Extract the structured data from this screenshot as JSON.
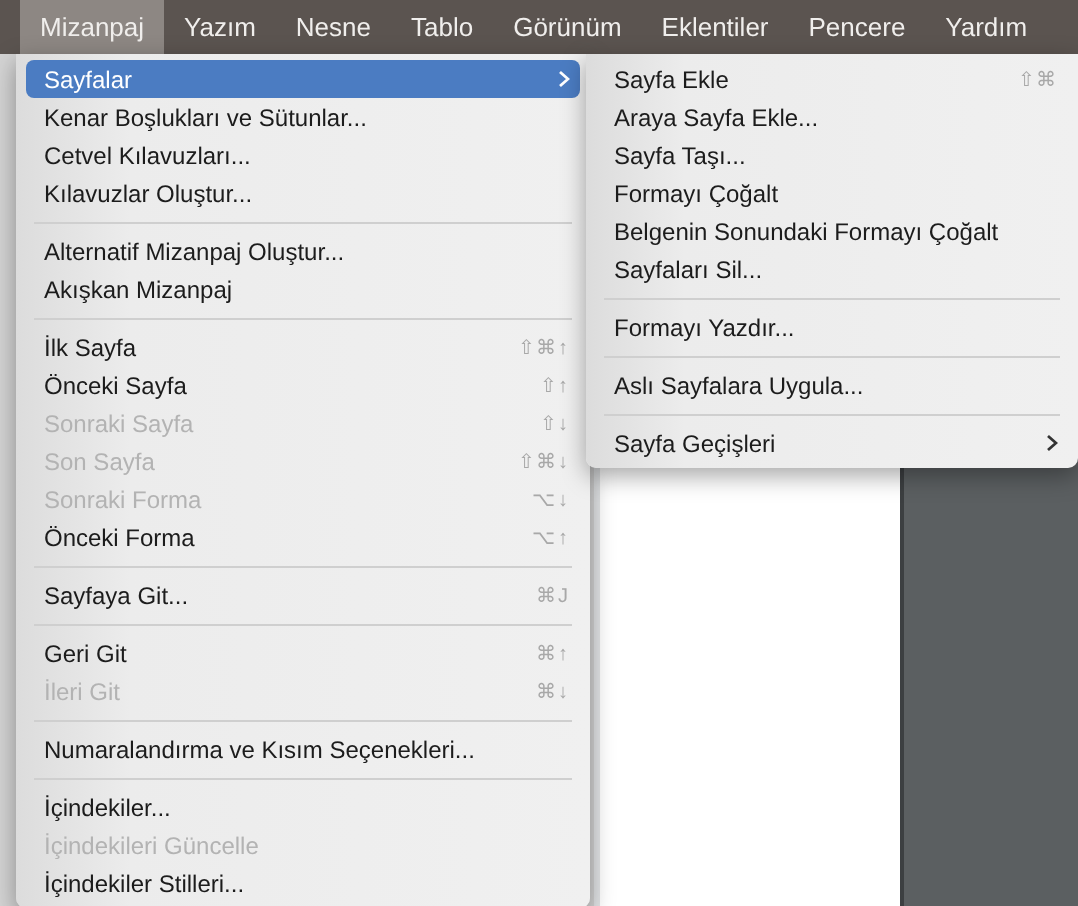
{
  "menu_bar": {
    "items": [
      {
        "label": "Mizanpaj",
        "selected": true
      },
      {
        "label": "Yazım",
        "selected": false
      },
      {
        "label": "Nesne",
        "selected": false
      },
      {
        "label": "Tablo",
        "selected": false
      },
      {
        "label": "Görünüm",
        "selected": false
      },
      {
        "label": "Eklentiler",
        "selected": false
      },
      {
        "label": "Pencere",
        "selected": false
      },
      {
        "label": "Yardım",
        "selected": false
      }
    ]
  },
  "menu": {
    "items": [
      {
        "kind": "submenu",
        "label": "Sayfalar",
        "selected": true,
        "disabled": false
      },
      {
        "kind": "item",
        "label": "Kenar Boşlukları ve Sütunlar...",
        "selected": false,
        "disabled": false
      },
      {
        "kind": "item",
        "label": "Cetvel Kılavuzları...",
        "selected": false,
        "disabled": false
      },
      {
        "kind": "item",
        "label": "Kılavuzlar Oluştur...",
        "selected": false,
        "disabled": false
      },
      {
        "kind": "separator"
      },
      {
        "kind": "item",
        "label": "Alternatif Mizanpaj Oluştur...",
        "selected": false,
        "disabled": false
      },
      {
        "kind": "item",
        "label": "Akışkan Mizanpaj",
        "selected": false,
        "disabled": false
      },
      {
        "kind": "separator"
      },
      {
        "kind": "item",
        "label": "İlk Sayfa",
        "shortcut": "⇧⌘↑",
        "selected": false,
        "disabled": false
      },
      {
        "kind": "item",
        "label": "Önceki Sayfa",
        "shortcut": "⇧↑",
        "selected": false,
        "disabled": false
      },
      {
        "kind": "item",
        "label": "Sonraki Sayfa",
        "shortcut": "⇧↓",
        "selected": false,
        "disabled": true
      },
      {
        "kind": "item",
        "label": "Son Sayfa",
        "shortcut": "⇧⌘↓",
        "selected": false,
        "disabled": true
      },
      {
        "kind": "item",
        "label": "Sonraki Forma",
        "shortcut": "⌥↓",
        "selected": false,
        "disabled": true
      },
      {
        "kind": "item",
        "label": "Önceki Forma",
        "shortcut": "⌥↑",
        "selected": false,
        "disabled": false
      },
      {
        "kind": "separator"
      },
      {
        "kind": "item",
        "label": "Sayfaya Git...",
        "shortcut": "⌘J",
        "selected": false,
        "disabled": false
      },
      {
        "kind": "separator"
      },
      {
        "kind": "item",
        "label": "Geri Git",
        "shortcut": "⌘↑",
        "selected": false,
        "disabled": false
      },
      {
        "kind": "item",
        "label": "İleri Git",
        "shortcut": "⌘↓",
        "selected": false,
        "disabled": true
      },
      {
        "kind": "separator"
      },
      {
        "kind": "item",
        "label": "Numaralandırma ve Kısım Seçenekleri...",
        "selected": false,
        "disabled": false
      },
      {
        "kind": "separator"
      },
      {
        "kind": "item",
        "label": "İçindekiler...",
        "selected": false,
        "disabled": false
      },
      {
        "kind": "item",
        "label": "İçindekileri Güncelle",
        "selected": false,
        "disabled": true
      },
      {
        "kind": "item",
        "label": "İçindekiler Stilleri...",
        "selected": false,
        "disabled": false
      }
    ]
  },
  "submenu": {
    "items": [
      {
        "kind": "item",
        "label": "Sayfa Ekle",
        "shortcut": "⇧⌘",
        "disabled": false
      },
      {
        "kind": "item",
        "label": "Araya Sayfa Ekle...",
        "disabled": false
      },
      {
        "kind": "item",
        "label": "Sayfa Taşı...",
        "disabled": false
      },
      {
        "kind": "item",
        "label": "Formayı Çoğalt",
        "disabled": false
      },
      {
        "kind": "item",
        "label": "Belgenin Sonundaki Formayı Çoğalt",
        "disabled": false
      },
      {
        "kind": "item",
        "label": "Sayfaları Sil...",
        "disabled": false
      },
      {
        "kind": "separator"
      },
      {
        "kind": "item",
        "label": "Formayı Yazdır...",
        "disabled": false
      },
      {
        "kind": "separator"
      },
      {
        "kind": "item",
        "label": "Aslı Sayfalara Uygula...",
        "disabled": false
      },
      {
        "kind": "separator"
      },
      {
        "kind": "submenu",
        "label": "Sayfa Geçişleri",
        "disabled": false
      }
    ]
  }
}
